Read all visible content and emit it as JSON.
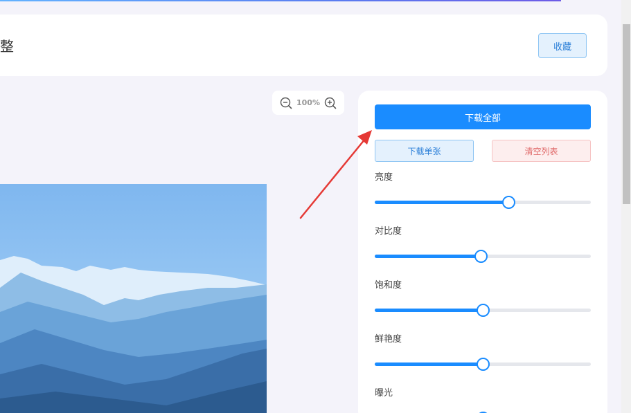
{
  "header": {
    "title": "整",
    "favorite_label": "收藏"
  },
  "zoom": {
    "level": "100%",
    "zoom_out_icon": "zoom-out-icon",
    "zoom_in_icon": "zoom-in-icon"
  },
  "panel": {
    "download_all_label": "下载全部",
    "download_single_label": "下载单张",
    "clear_list_label": "清空列表",
    "sliders": [
      {
        "label": "亮度",
        "value": 0.62
      },
      {
        "label": "对比度",
        "value": 0.49
      },
      {
        "label": "饱和度",
        "value": 0.5
      },
      {
        "label": "鲜艳度",
        "value": 0.5
      },
      {
        "label": "曝光",
        "value": 0.5
      }
    ]
  },
  "colors": {
    "accent": "#1a8cff",
    "danger": "#e06a6a",
    "annotation_arrow": "#e53935"
  }
}
